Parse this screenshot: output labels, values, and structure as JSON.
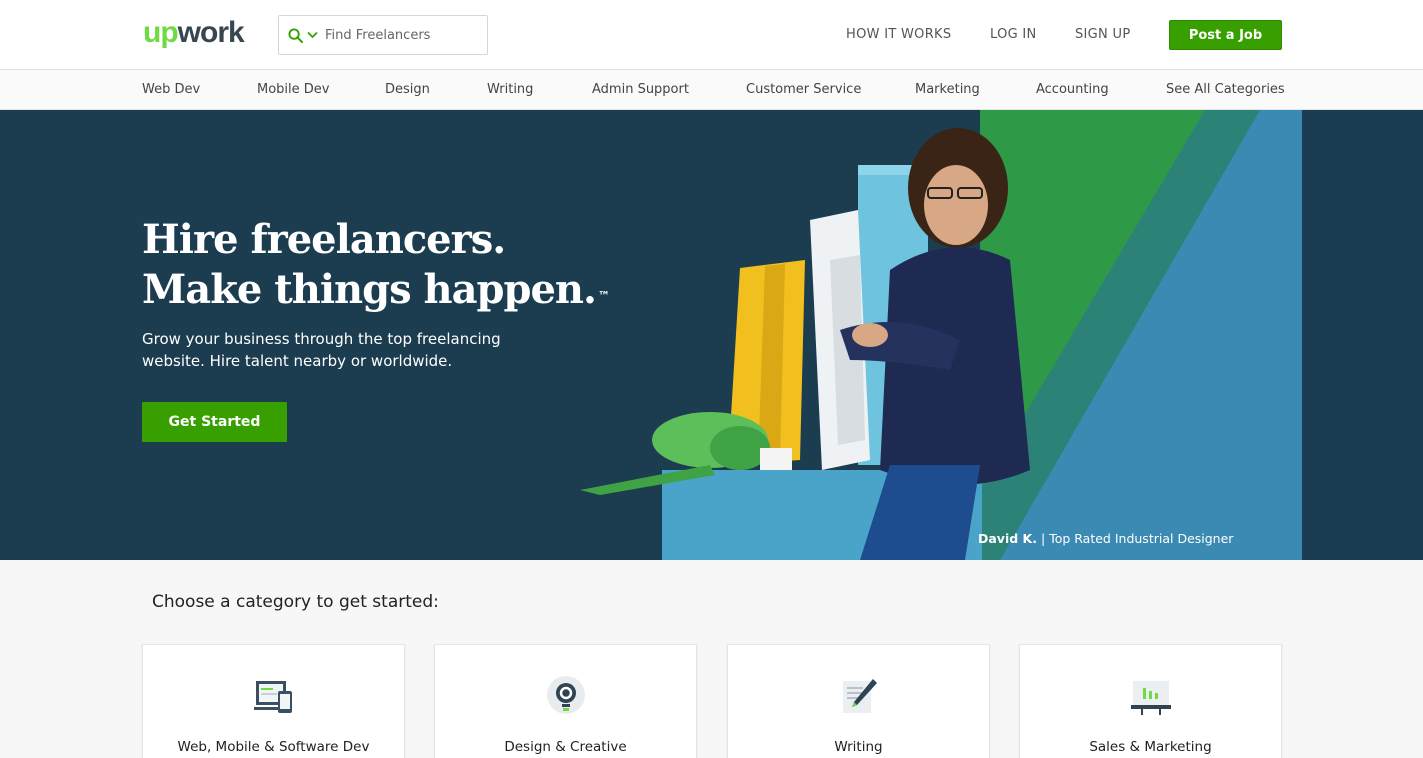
{
  "header": {
    "logo_up": "up",
    "logo_work": "work",
    "search_placeholder": "Find Freelancers",
    "links": [
      "HOW IT WORKS",
      "LOG IN",
      "SIGN UP"
    ],
    "post_job": "Post a Job"
  },
  "catnav": {
    "items": [
      "Web Dev",
      "Mobile Dev",
      "Design",
      "Writing",
      "Admin Support",
      "Customer Service",
      "Marketing",
      "Accounting",
      "See All Categories"
    ]
  },
  "hero": {
    "headline_1": "Hire freelancers.",
    "headline_2": "Make things happen.",
    "tm": "™",
    "subtext": "Grow your business through the top freelancing website. Hire talent nearby or worldwide.",
    "cta": "Get Started",
    "caption_name": "David K.",
    "caption_sep": "|",
    "caption_role": "Top Rated Industrial Designer"
  },
  "categories": {
    "heading": "Choose a category to get started:",
    "cards": [
      {
        "label": "Web, Mobile & Software Dev",
        "icon": "devices-icon"
      },
      {
        "label": "Design & Creative",
        "icon": "lightbulb-gear-icon"
      },
      {
        "label": "Writing",
        "icon": "pen-document-icon"
      },
      {
        "label": "Sales & Marketing",
        "icon": "chart-board-icon"
      }
    ]
  },
  "colors": {
    "brand_green": "#37a000",
    "logo_green": "#6fda44",
    "hero_bg": "#1c3c50"
  }
}
